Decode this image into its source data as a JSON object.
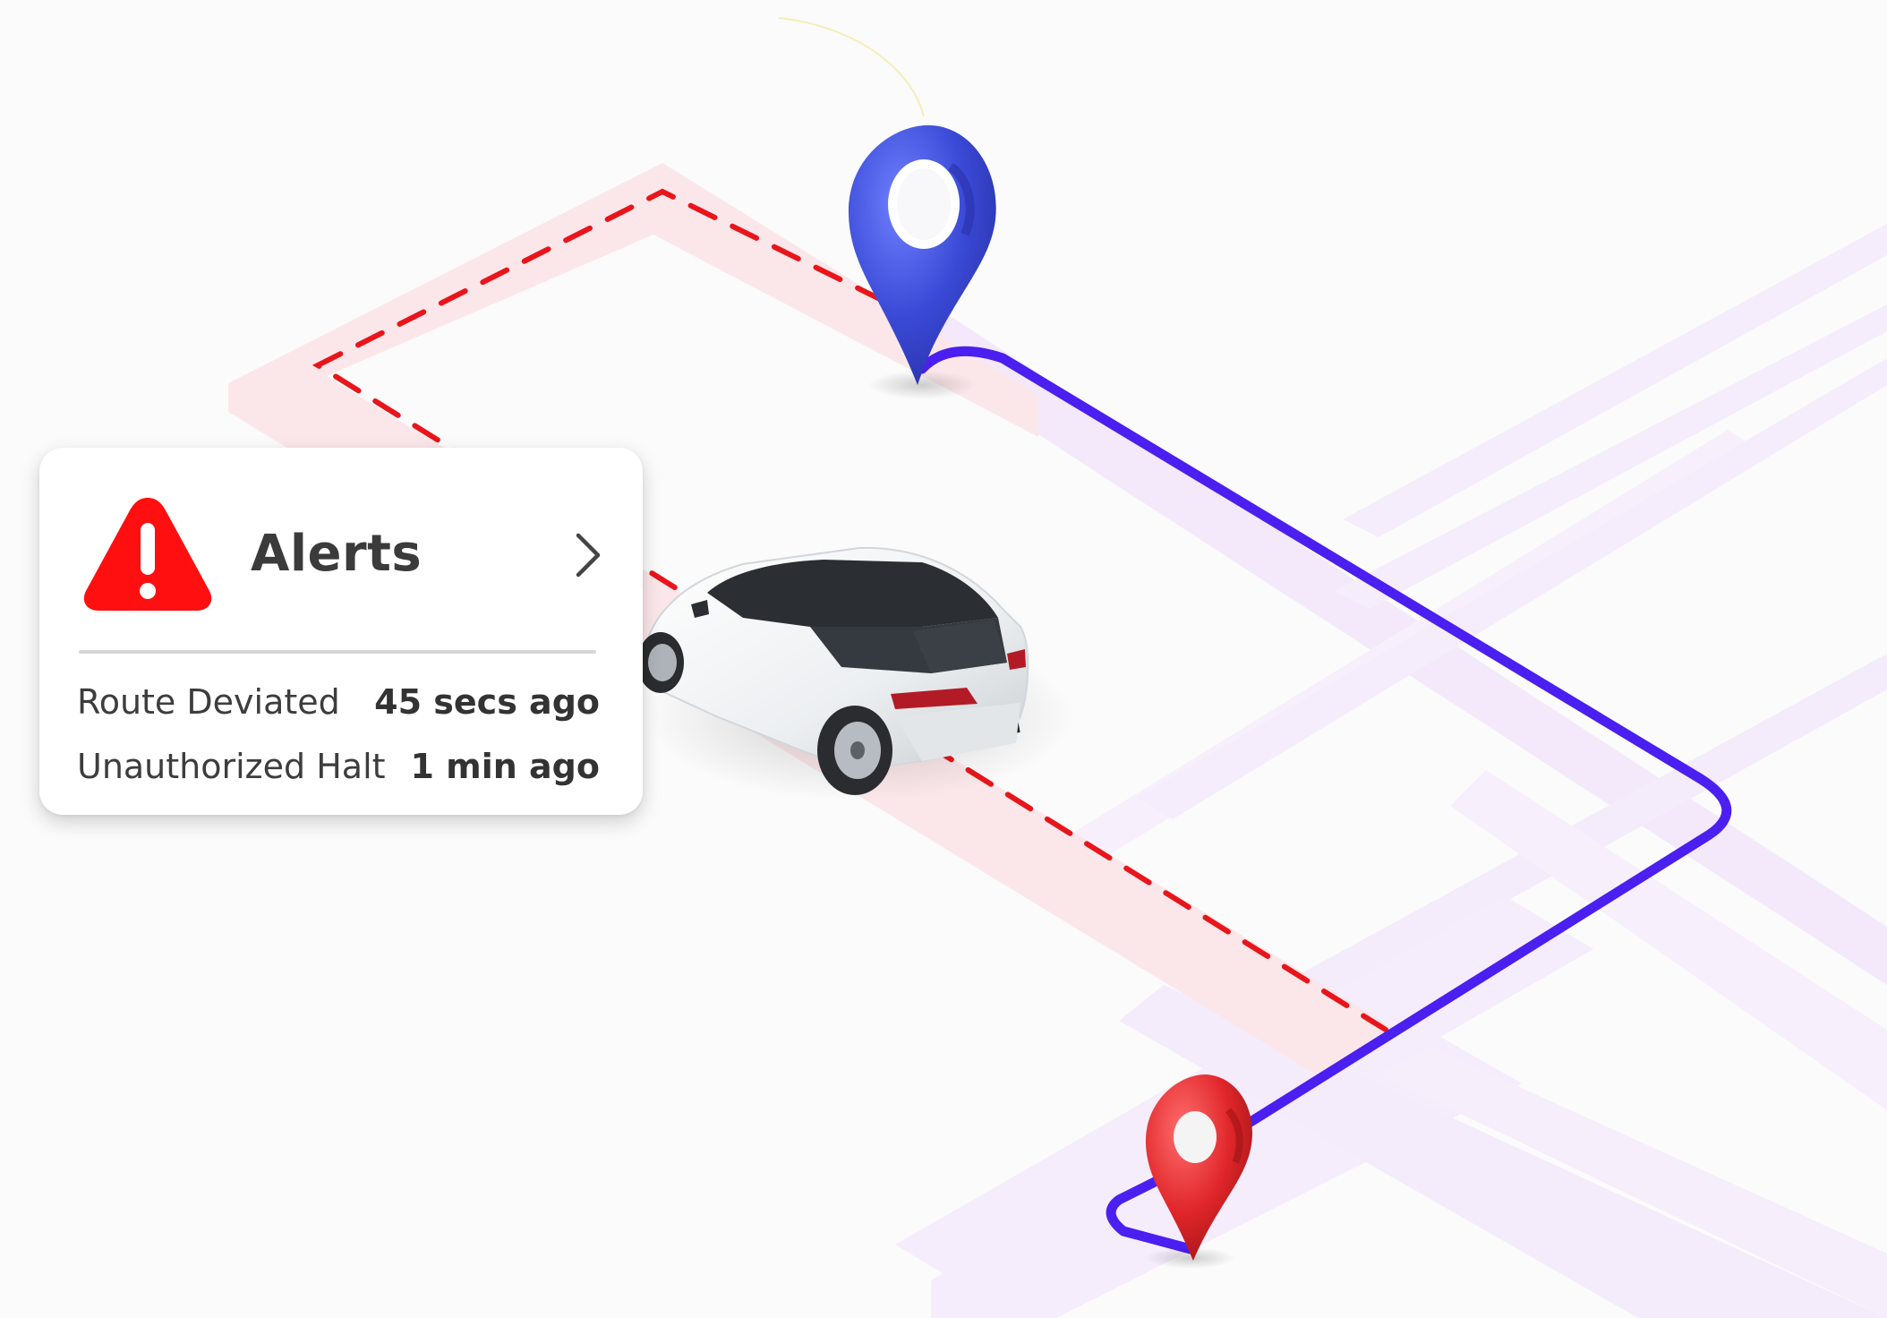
{
  "alerts_card": {
    "title": "Alerts",
    "items": [
      {
        "label": "Route Deviated",
        "time": "45 secs ago"
      },
      {
        "label": "Unauthorized Halt",
        "time": "1 min ago"
      }
    ]
  },
  "icons": {
    "warning": "warning-triangle-icon",
    "open": "chevron-right-icon",
    "start_pin": "location-pin-icon",
    "destination_pin": "location-pin-icon"
  },
  "colors": {
    "alert_red": "#ff1010",
    "route_blue": "#4a1ff0",
    "deviation_red": "#e8151b",
    "pin_blue": "#3f4fd9",
    "pin_red": "#e0262a"
  }
}
